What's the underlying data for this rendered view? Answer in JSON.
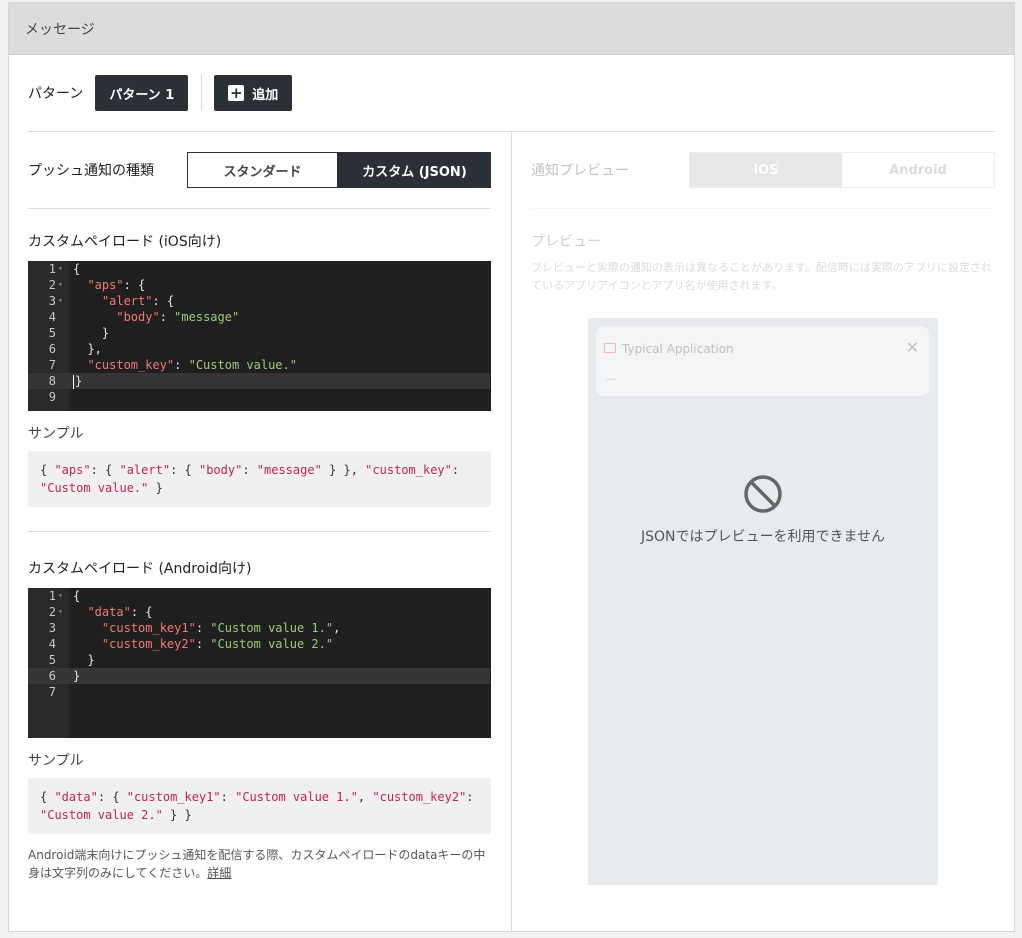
{
  "header": {
    "title": "メッセージ"
  },
  "pattern": {
    "label": "パターン",
    "selected": "パターン 1",
    "add_label": "追加"
  },
  "push_type": {
    "label": "プッシュ通知の種類",
    "standard": "スタンダード",
    "custom": "カスタム (JSON)"
  },
  "ios": {
    "title": "カスタムペイロード (iOS向け)",
    "sample_label": "サンプル",
    "sample_line1_pre": "{ ",
    "sample_tokens": [
      "\"aps\"",
      ": { ",
      "\"alert\"",
      ": { ",
      "\"body\"",
      ": ",
      "\"message\"",
      " } }, ",
      "\"custom_key\"",
      ":"
    ],
    "sample_line2_value": "\"Custom value.\"",
    "sample_line2_post": " }"
  },
  "android": {
    "title": "カスタムペイロード (Android向け)",
    "sample_label": "サンプル",
    "sample_line1_pre": "{ ",
    "sample_tokens": [
      "\"data\"",
      ": { ",
      "\"custom_key1\"",
      ": ",
      "\"Custom value 1.\"",
      ", ",
      "\"custom_key2\"",
      ":"
    ],
    "sample_line2_value": "\"Custom value 2.\"",
    "sample_line2_post": " } }"
  },
  "note": {
    "text": "Android端末向けにプッシュ通知を配信する際、カスタムペイロードのdataキーの中身は文字列のみにしてください。",
    "link": "詳細"
  },
  "preview": {
    "label": "通知プレビュー",
    "ios": "iOS",
    "android": "Android",
    "title": "プレビュー",
    "desc": "プレビューと実際の通知の表示は異なることがあります。配信時には実際のアプリに設定されているアプリアイコンとアプリ名が使用されます。",
    "app_name": "Typical Application",
    "dash": "—",
    "unavailable": "JSONではプレビューを利用できません"
  },
  "colors": {
    "dark_button": "#2b2f36",
    "code_bg": "#1f1f1f",
    "json_key": "#f07a7a",
    "json_string": "#9ecb7a",
    "sample_token": "#c0264c"
  }
}
